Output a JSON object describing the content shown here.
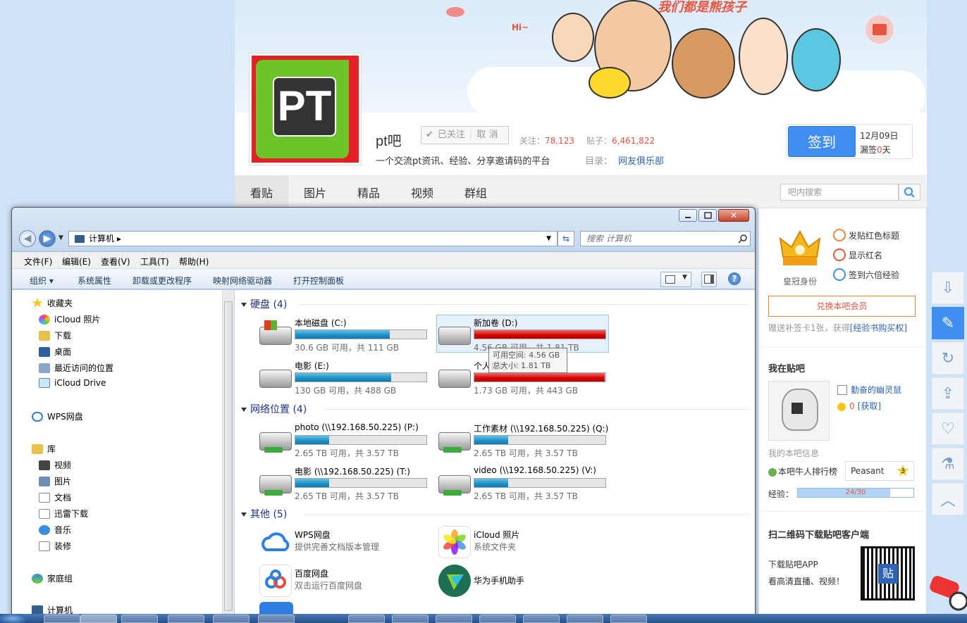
{
  "banner": {
    "headline": "我们都是熊孩子",
    "greeting": "Hi~"
  },
  "forum": {
    "name": "pt吧",
    "logo_text": "PT",
    "follow_label": "已关注",
    "unfollow_label": "取 消",
    "followers_label": "关注：",
    "followers": "78,123",
    "posts_label": "贴子：",
    "posts": "6,461,822",
    "slogan": "一个交流pt资讯、经验、分享邀请码的平台",
    "catalog_label": "目录：",
    "catalog_value": "网友俱乐部"
  },
  "sign": {
    "button": "签到",
    "date": "12月09日",
    "missed_prefix": "漏签",
    "missed_count": "0",
    "missed_suffix": "天"
  },
  "tabs": [
    {
      "label": "看贴",
      "active": true
    },
    {
      "label": "图片"
    },
    {
      "label": "精品"
    },
    {
      "label": "视频"
    },
    {
      "label": "群组"
    }
  ],
  "tieba_search": {
    "placeholder": "吧内搜索"
  },
  "privileges": {
    "crown_label": "皇冠身份",
    "items": [
      "发贴红色标题",
      "显示红名",
      "签到六倍经验"
    ],
    "member_button": "兑换本吧会员",
    "card_text": "赠送补签卡1张，获得",
    "card_link": "[经验书购买权]"
  },
  "my_tieba": {
    "title": "我在贴吧",
    "user_name": "勤奋的幽灵鼠",
    "coins": "0",
    "coins_link": "[获取]",
    "info_label": "我的本吧信息",
    "rank_label": "本吧牛人排行榜",
    "level_name": "Peasant",
    "level_number": "3",
    "exp_label": "经验：",
    "exp_text": "24/30",
    "exp_fraction": 0.8
  },
  "qr": {
    "title": "扫二维码下载贴吧客户端",
    "line1": "下载贴吧APP",
    "line2": "看高清直播、视频！"
  },
  "side_tools": [
    "download-icon",
    "edit-icon",
    "refresh-icon",
    "share-icon",
    "heart-icon",
    "lab-icon",
    "back-to-top-icon"
  ],
  "explorer": {
    "path": "计算机",
    "search_placeholder": "搜索 计算机",
    "menus": [
      "文件(F)",
      "编辑(E)",
      "查看(V)",
      "工具(T)",
      "帮助(H)"
    ],
    "commands": [
      "组织 ▾",
      "系统属性",
      "卸载或更改程序",
      "映射网络驱动器",
      "打开控制面板"
    ],
    "nav": {
      "favorites": "收藏夹",
      "favorites_items": [
        "iCloud 照片",
        "下载",
        "桌面",
        "最近访问的位置",
        "iCloud Drive"
      ],
      "wps": "WPS网盘",
      "library": "库",
      "library_items": [
        "视频",
        "图片",
        "文档",
        "迅雷下载",
        "音乐",
        "装修"
      ],
      "homegroup": "家庭组",
      "computer": "计算机"
    },
    "groups": {
      "disks": "硬盘 (4)",
      "network": "网络位置 (4)",
      "other": "其他 (5)"
    },
    "disks": [
      {
        "name": "本地磁盘 (C:)",
        "info": "30.6 GB 可用，共 111 GB",
        "used": 0.72,
        "full": false
      },
      {
        "name": "新加卷 (D:)",
        "info": "4.56 GB 可用，共 1.81 TB",
        "used": 0.998,
        "full": true
      },
      {
        "name": "电影 (E:)",
        "info": "130 GB 可用，共 488 GB",
        "used": 0.73,
        "full": false
      },
      {
        "name": "个人数据 (F:)",
        "info": "1.73 GB 可用，共 443 GB",
        "used": 0.996,
        "full": true
      }
    ],
    "tooltip": {
      "line1": "可用空间: 4.56 GB",
      "line2": "总大小: 1.81 TB"
    },
    "network": [
      {
        "name": "photo (\\\\192.168.50.225) (P:)",
        "info": "2.65 TB 可用，共 3.57 TB",
        "used": 0.26
      },
      {
        "name": "工作素材 (\\\\192.168.50.225) (Q:)",
        "info": "2.65 TB 可用，共 3.57 TB",
        "used": 0.26
      },
      {
        "name": "电影 (\\\\192.168.50.225) (T:)",
        "info": "2.65 TB 可用，共 3.57 TB",
        "used": 0.26
      },
      {
        "name": "video (\\\\192.168.50.225) (V:)",
        "info": "2.65 TB 可用，共 3.57 TB",
        "used": 0.26
      }
    ],
    "other": [
      {
        "name": "WPS网盘",
        "desc": "提供完善文档版本管理",
        "color": "#2f7fe0"
      },
      {
        "name": "iCloud 照片",
        "desc": "系统文件夹",
        "color": "#f2a33a"
      },
      {
        "name": "百度网盘",
        "desc": "双击运行百度网盘",
        "color": "#2f7fe0"
      },
      {
        "name": "华为手机助手",
        "desc": "",
        "color": "#2a9d6a"
      }
    ]
  },
  "colors": {
    "accent": "#3f8ef0",
    "link": "#2d64b3",
    "highlight": "#e8543c",
    "disk_ok": "#1c8fc6",
    "disk_full": "#d40000"
  }
}
